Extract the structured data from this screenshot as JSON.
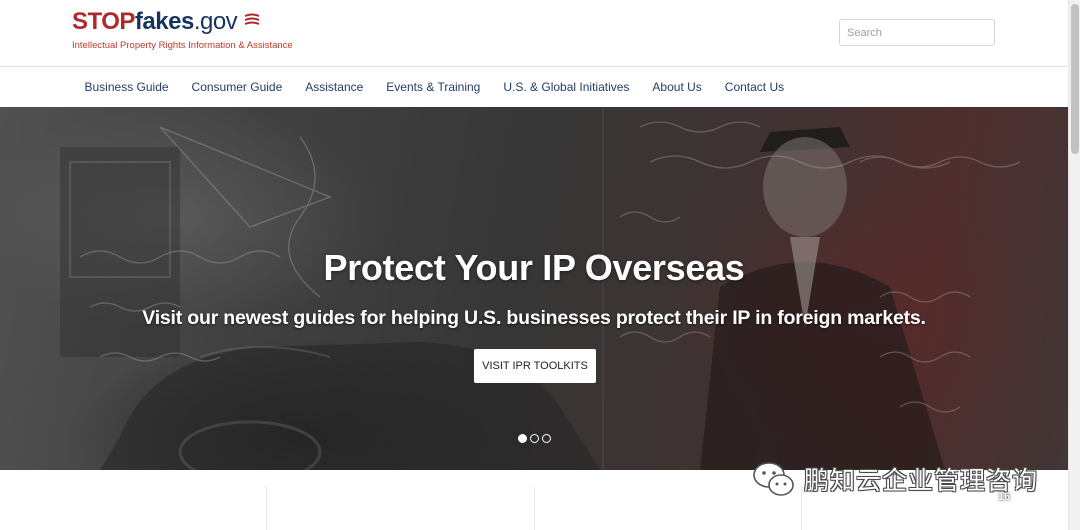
{
  "site": {
    "logo_stop": "STOP",
    "logo_fakes": "fakes",
    "logo_gov": ".gov",
    "tagline": "Intellectual Property Rights Information & Assistance"
  },
  "search": {
    "placeholder": "Search",
    "value": ""
  },
  "nav": {
    "items": [
      {
        "label": "Business Guide"
      },
      {
        "label": "Consumer Guide"
      },
      {
        "label": "Assistance"
      },
      {
        "label": "Events & Training"
      },
      {
        "label": "U.S. & Global Initiatives"
      },
      {
        "label": "About Us"
      },
      {
        "label": "Contact Us"
      }
    ]
  },
  "hero": {
    "title": "Protect Your IP Overseas",
    "subtitle": "Visit our newest guides for helping U.S. businesses protect their IP in foreign markets.",
    "button_label": "VISIT IPR TOOLKITS",
    "slides_total": 3,
    "active_slide": 1
  },
  "watermark": {
    "text": "鹏知云企业管理咨询",
    "badge": "16"
  },
  "colors": {
    "brand_red": "#b0282c",
    "brand_navy": "#16345e",
    "nav_text": "#233d63"
  }
}
